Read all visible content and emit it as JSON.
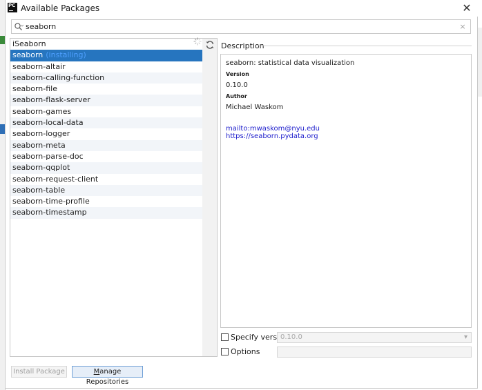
{
  "window": {
    "app_icon_text": "PC",
    "title": "Available Packages",
    "close_glyph": "✕"
  },
  "search": {
    "value": "seaborn",
    "placeholder": "",
    "clear_glyph": "×"
  },
  "packages": [
    {
      "name": "iSeaborn",
      "status": ""
    },
    {
      "name": "seaborn",
      "status": "(installing)",
      "selected": true
    },
    {
      "name": "seaborn-altair",
      "status": ""
    },
    {
      "name": "seaborn-calling-function",
      "status": ""
    },
    {
      "name": "seaborn-file",
      "status": ""
    },
    {
      "name": "seaborn-flask-server",
      "status": ""
    },
    {
      "name": "seaborn-games",
      "status": ""
    },
    {
      "name": "seaborn-local-data",
      "status": ""
    },
    {
      "name": "seaborn-logger",
      "status": ""
    },
    {
      "name": "seaborn-meta",
      "status": ""
    },
    {
      "name": "seaborn-parse-doc",
      "status": ""
    },
    {
      "name": "seaborn-qqplot",
      "status": ""
    },
    {
      "name": "seaborn-request-client",
      "status": ""
    },
    {
      "name": "seaborn-table",
      "status": ""
    },
    {
      "name": "seaborn-time-profile",
      "status": ""
    },
    {
      "name": "seaborn-timestamp",
      "status": ""
    }
  ],
  "description": {
    "header": "Description",
    "summary": "seaborn: statistical data visualization",
    "version_label": "Version",
    "version": "0.10.0",
    "author_label": "Author",
    "author": "Michael Waskom",
    "links": [
      "mailto:mwaskom@nyu.edu",
      "https://seaborn.pydata.org"
    ]
  },
  "options": {
    "specify_version_label": "Specify version",
    "specify_version_checked": false,
    "version_value": "0.10.0",
    "options_label": "Options",
    "options_checked": false,
    "options_value": ""
  },
  "buttons": {
    "install_label": "Install Package",
    "manage_mnemonic": "M",
    "manage_rest": "anage Repositories"
  },
  "colors": {
    "selection": "#2675bf",
    "installing_text": "#4fa0ff",
    "link": "#1d1dcc"
  },
  "icons": [
    "app-icon",
    "close-icon",
    "search-icon",
    "clear-search-icon",
    "loading-spinner-icon",
    "refresh-icon",
    "chevron-down-icon"
  ]
}
